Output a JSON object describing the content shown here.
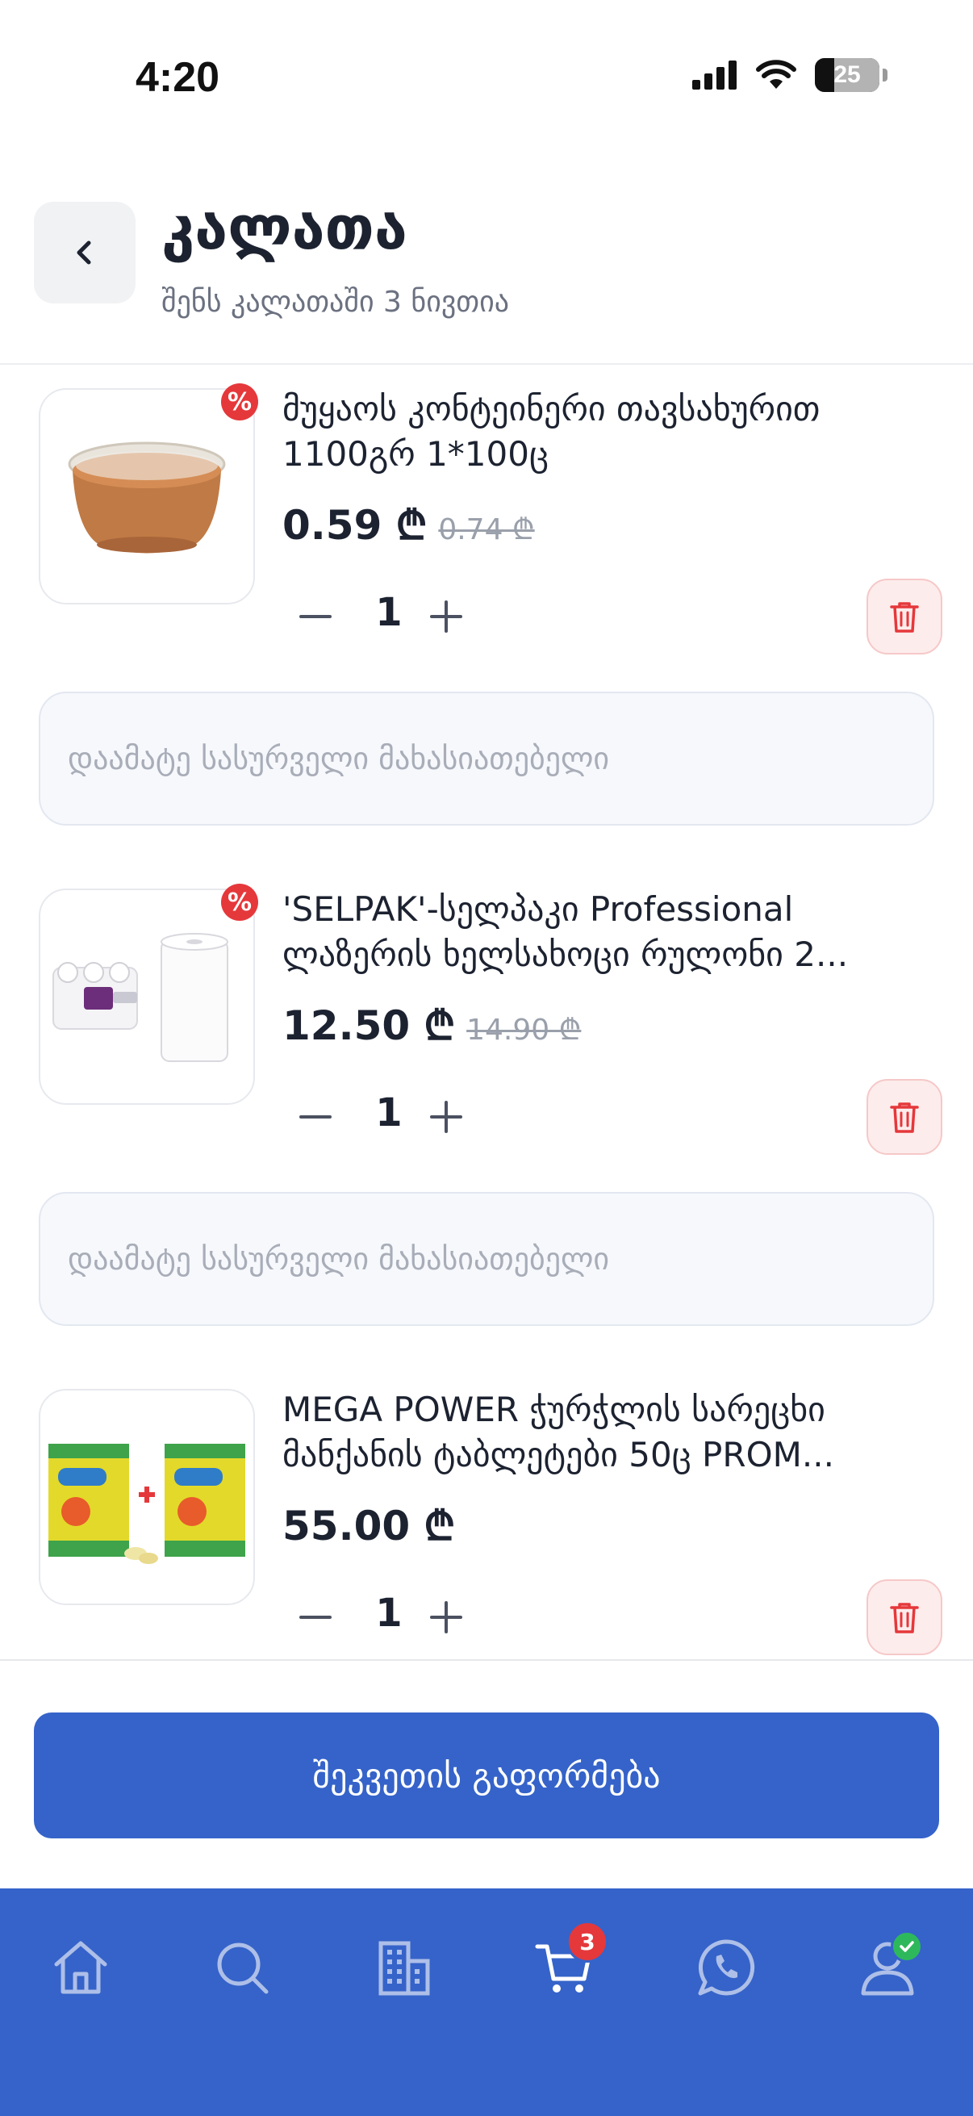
{
  "status_bar": {
    "time": "4:20",
    "battery": "25"
  },
  "header": {
    "title": "კალათა",
    "subtitle": "შენს კალათაში 3 ნივთია"
  },
  "items": [
    {
      "name_line1": "მუყაოს კონტეინერი თავსახურით",
      "name_line2": "1100გრ 1*100ც",
      "price": "0.59 ₾",
      "old_price": "0.74 ₾",
      "quantity": "1",
      "discount_badge": "%",
      "note_placeholder": "დაამატე სასურველი მახასიათებელი"
    },
    {
      "name_line1": "'SELPAK'-სელპაკი Professional",
      "name_line2": "ლაზერის ხელსახოცი რულონი 2...",
      "price": "12.50 ₾",
      "old_price": "14.90 ₾",
      "quantity": "1",
      "discount_badge": "%",
      "note_placeholder": "დაამატე სასურველი მახასიათებელი"
    },
    {
      "name_line1": "MEGA POWER ჭურჭლის სარეცხი",
      "name_line2": "მანქანის ტაბლეტები 50ც PROM...",
      "price": "55.00 ₾",
      "quantity": "1"
    }
  ],
  "checkout": {
    "label": "შეკვეთის გაფორმება"
  },
  "bottom_nav": {
    "cart_count": "3",
    "items": [
      "home-icon",
      "search-icon",
      "buildings-icon",
      "cart-icon",
      "whatsapp-icon",
      "profile-icon"
    ]
  },
  "colors": {
    "primary": "#3563c9",
    "danger": "#e5383b",
    "success": "#2eb85c"
  }
}
